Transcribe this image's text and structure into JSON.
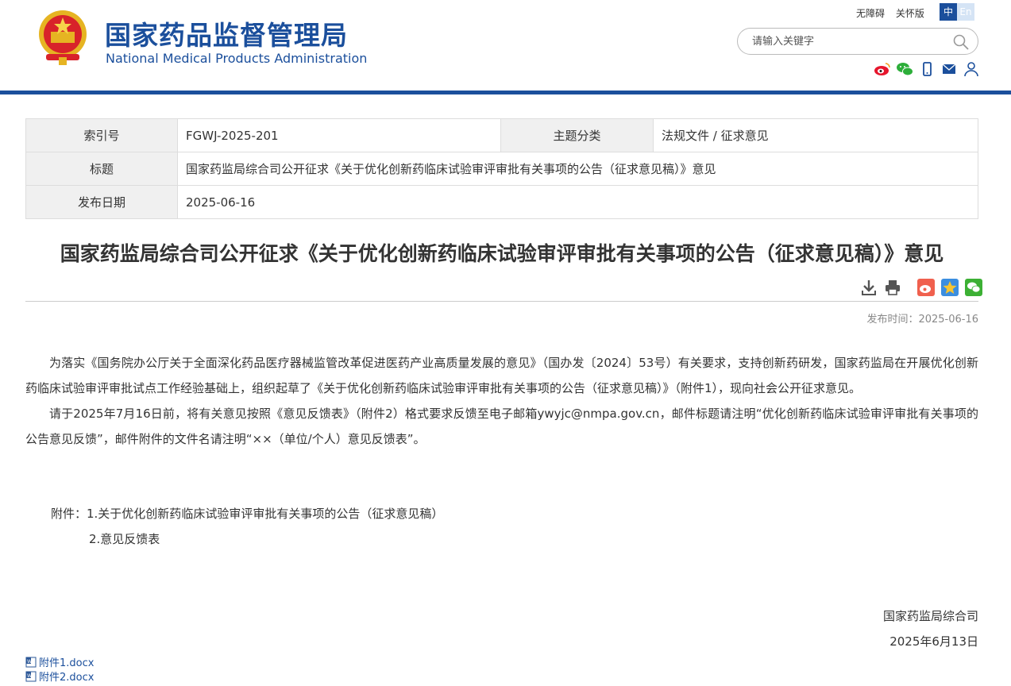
{
  "header": {
    "title_cn": "国家药品监督管理局",
    "title_en": "National Medical Products Administration",
    "accessibility": "无障碍",
    "care_version": "关怀版",
    "lang_zh": "中",
    "lang_en": "En",
    "search_placeholder": "请输入关键字",
    "social_icons": [
      "weibo-icon",
      "wechat-icon",
      "mobile-icon",
      "mail-icon",
      "user-icon"
    ]
  },
  "info": {
    "index_label": "索引号",
    "index_value": "FGWJ-2025-201",
    "category_label": "主题分类",
    "category_value": "法规文件 / 征求意见",
    "title_label": "标题",
    "title_value": "国家药监局综合司公开征求《关于优化创新药临床试验审评审批有关事项的公告（征求意见稿）》意见",
    "date_label": "发布日期",
    "date_value": "2025-06-16"
  },
  "article": {
    "title": "国家药监局综合司公开征求《关于优化创新药临床试验审评审批有关事项的公告（征求意见稿）》意见",
    "publish_time": "发布时间：2025-06-16",
    "paragraph_1": "为落实《国务院办公厅关于全面深化药品医疗器械监管改革促进医药产业高质量发展的意见》（国办发〔2024〕53号）有关要求，支持创新药研发，国家药监局在开展优化创新药临床试验审评审批试点工作经验基础上，组织起草了《关于优化创新药临床试验审评审批有关事项的公告（征求意见稿）》（附件1），现向社会公开征求意见。",
    "paragraph_2": "请于2025年7月16日前，将有关意见按照《意见反馈表》（附件2）格式要求反馈至电子邮箱ywyjc@nmpa.gov.cn，邮件标题请注明“优化创新药临床试验审评审批有关事项的公告意见反馈”，邮件附件的文件名请注明“××（单位/个人）意见反馈表”。",
    "attachment_1": "附件：1.关于优化创新药临床试验审评审批有关事项的公告（征求意见稿）",
    "attachment_2": "2.意见反馈表",
    "signer": "国家药监局综合司",
    "sign_date": "2025年6月13日",
    "files": [
      "附件1.docx",
      "附件2.docx"
    ]
  },
  "colors": {
    "brand": "#1b4f9c",
    "table_header_bg": "#f0f0f0"
  },
  "tool_icons": [
    "download-icon",
    "print-icon",
    "weibo-share-icon",
    "qzone-share-icon",
    "wechat-share-icon"
  ]
}
